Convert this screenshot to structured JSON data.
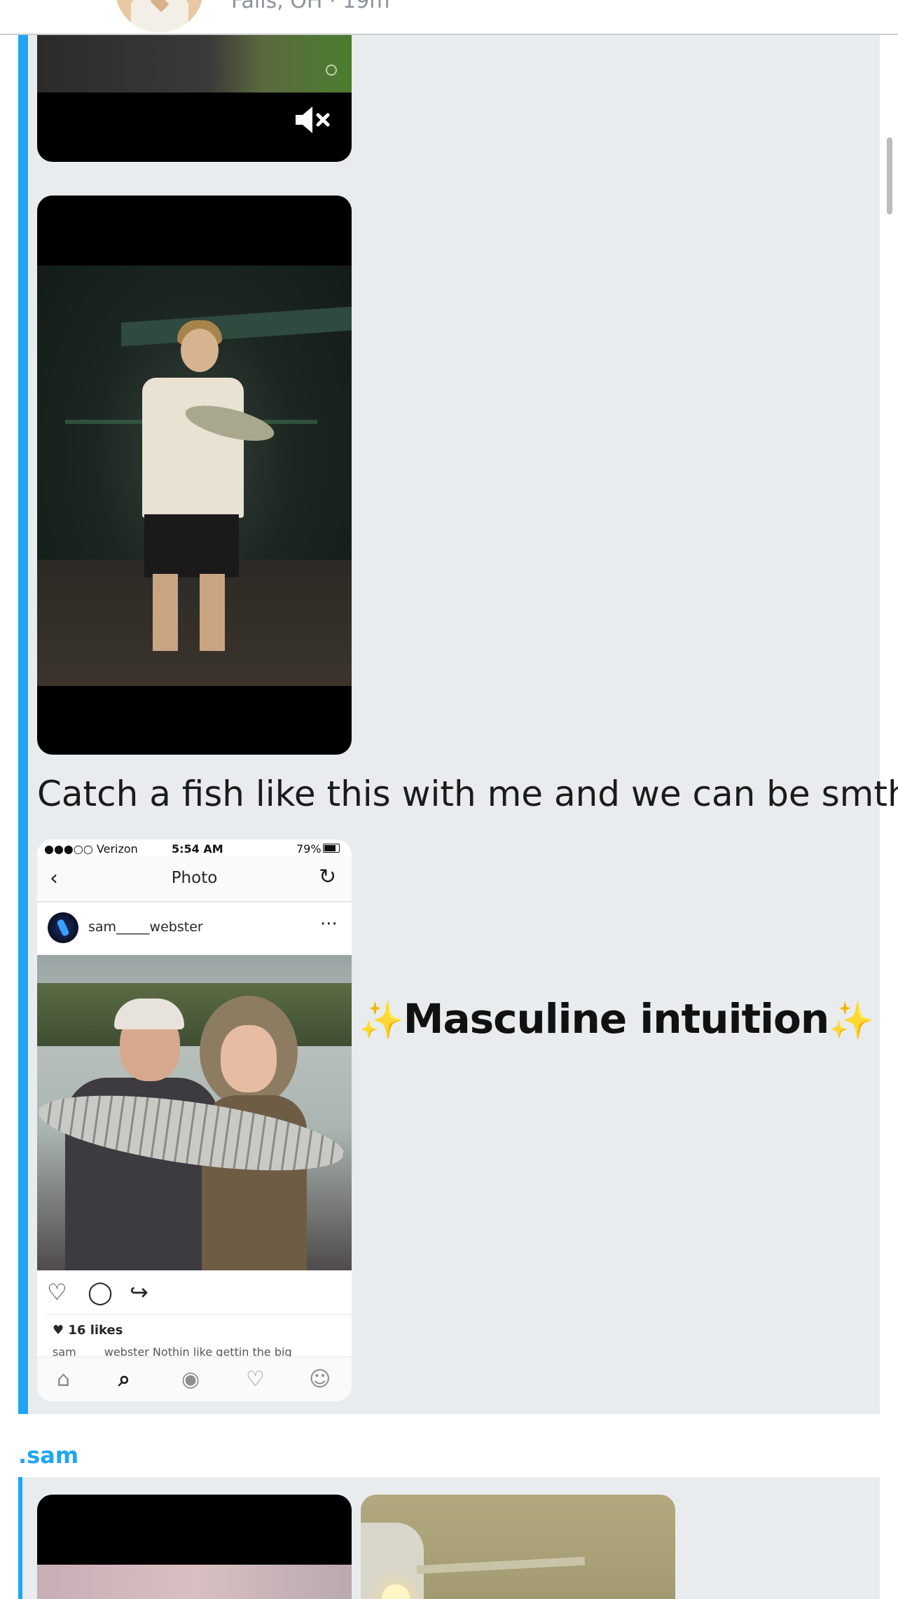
{
  "header": {
    "location_text": "Falls, OH · 19m"
  },
  "post1": {
    "mute_icon": "speaker-mute-icon",
    "caption": "Catch a fish like this with me and we can be smth",
    "overlay_text": "Masculine intuition",
    "overlay_spark": "✨"
  },
  "instagram_screenshot": {
    "status": {
      "carrier": "●●●○○ Verizon",
      "time": "5:54 AM",
      "battery": "79%"
    },
    "nav": {
      "back": "‹",
      "title": "Photo",
      "refresh": "↻"
    },
    "user": {
      "username": "sam_____webster",
      "more": "···"
    },
    "actions": {
      "like": "♡",
      "comment": "◯",
      "share": "↪"
    },
    "likes": "♥ 16 likes",
    "caption_cut": "sam_____webster Nothin like gettin the big",
    "tabs": [
      "⌂",
      "⌕",
      "◉",
      "♡",
      "☺"
    ]
  },
  "post2": {
    "author": ".sam"
  }
}
